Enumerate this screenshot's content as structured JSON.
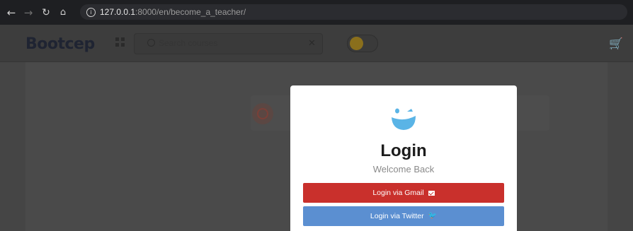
{
  "browser": {
    "url_host": "127.0.0.1",
    "url_path": ":8000/en/become_a_teacher/"
  },
  "site": {
    "logo_text": "Bootcep",
    "search_placeholder": "Search courses"
  },
  "modal": {
    "title": "Login",
    "subtitle": "Welcome Back",
    "gmail_button_label": "Login via Gmail",
    "twitter_button_label": "Login via Twitter",
    "gmail_color": "#c9302c",
    "twitter_color": "#5b8fd1"
  },
  "icons": {
    "back": "arrow-left-icon",
    "forward": "arrow-right-icon",
    "reload": "reload-icon",
    "home": "home-icon",
    "info": "info-icon",
    "grid": "grid-icon",
    "search": "search-icon",
    "clear": "close-icon",
    "cart": "cart-icon",
    "mail": "mail-icon",
    "twitter": "twitter-icon",
    "modal_logo": "smiley-logo-icon"
  }
}
